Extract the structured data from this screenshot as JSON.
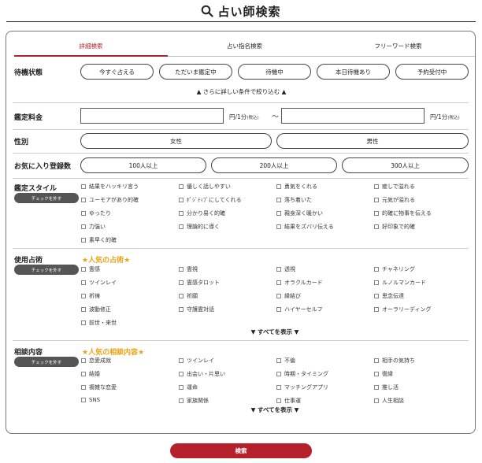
{
  "page": {
    "title": "占い師検索",
    "search_icon": "search-icon"
  },
  "tabs": [
    {
      "label": "詳細検索",
      "active": true
    },
    {
      "label": "占い指名検索",
      "active": false
    },
    {
      "label": "フリーワード検索",
      "active": false
    }
  ],
  "waiting": {
    "label": "待機状態",
    "options": [
      "今すぐ占える",
      "ただいま鑑定中",
      "待機中",
      "本日待機あり",
      "予約受付中"
    ]
  },
  "more_filter": "▲ さらに詳しい条件で絞り込む ▲",
  "fee": {
    "label": "鑑定料金",
    "unit_main": "円/1分",
    "unit_tax": "(税込)",
    "tilde": "〜"
  },
  "gender": {
    "label": "性別",
    "options": [
      "女性",
      "男性"
    ]
  },
  "favorites": {
    "label": "お気に入り登録数",
    "options": [
      "100人以上",
      "200人以上",
      "300人以上"
    ]
  },
  "style": {
    "label": "鑑定スタイル",
    "clear_label": "チェックを外す",
    "items": [
      "結果をハッキリ言う",
      "優しく話しやすい",
      "勇気をくれる",
      "癒しで溢れる",
      "ユーモアがあり的確",
      "ﾎﾟｼﾞﾃｨﾌﾞにしてくれる",
      "落ち着いた",
      "元気が溢れる",
      "ゆったり",
      "分かり易く的確",
      "親身深く暖かい",
      "的確に物事を伝える",
      "力強い",
      "理論的に導く",
      "結果をズバリ伝える",
      "好印象で的確",
      "素早く的確"
    ]
  },
  "divination": {
    "label": "使用占術",
    "clear_label": "チェックを外す",
    "popular": "★人気の占術★",
    "items": [
      "霊感",
      "霊視",
      "透視",
      "チャネリング",
      "ツインレイ",
      "霊感タロット",
      "オラクルカード",
      "ルノルマンカード",
      "祈祷",
      "祈願",
      "縁結び",
      "思念伝達",
      "波動修正",
      "守護霊対話",
      "ハイヤーセルフ",
      "オーラリーディング",
      "前世・来世"
    ],
    "show_all": "▼ すべてを表示 ▼"
  },
  "consult": {
    "label": "相談内容",
    "clear_label": "チェックを外す",
    "popular": "★人気の相談内容★",
    "items": [
      "恋愛成就",
      "ツインレイ",
      "不倫",
      "相手の気持ち",
      "結婚",
      "出会い・片思い",
      "時期・タイミング",
      "復縁",
      "複雑な恋愛",
      "運命",
      "マッチングアプリ",
      "推し活",
      "SNS",
      "家族関係",
      "仕事運",
      "人生相談"
    ],
    "show_all": "▼ すべてを表示 ▼"
  },
  "search_button": "検索",
  "colors": {
    "accent": "#b5202a",
    "popular": "#e8a317",
    "clear_button": "#555555"
  }
}
